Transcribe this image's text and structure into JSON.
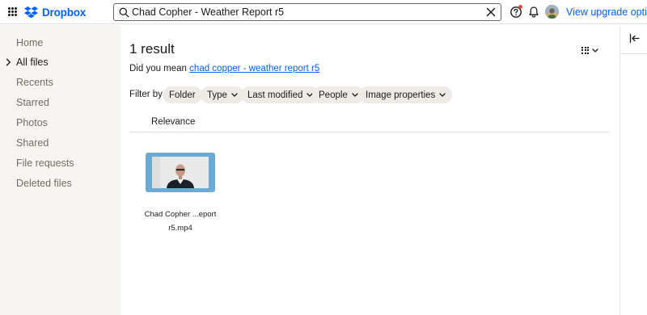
{
  "header": {
    "brand": "Dropbox",
    "brand_color": "#0061fe",
    "search": {
      "value": "Chad Copher - Weather Report r5",
      "placeholder": "Search"
    },
    "icons": [
      "apps-grid-icon",
      "dropbox-logo-icon",
      "search-icon",
      "clear-icon",
      "help-icon",
      "bell-icon"
    ],
    "notification_dot_color": "#d14f3b",
    "upgrade_link": "View upgrade options"
  },
  "sidebar": {
    "items": [
      {
        "label": "Home",
        "active": false
      },
      {
        "label": "All files",
        "active": true
      },
      {
        "label": "Recents",
        "active": false
      },
      {
        "label": "Starred",
        "active": false
      },
      {
        "label": "Photos",
        "active": false
      },
      {
        "label": "Shared",
        "active": false
      },
      {
        "label": "File requests",
        "active": false
      },
      {
        "label": "Deleted files",
        "active": false
      }
    ]
  },
  "main": {
    "result_title": "1 result",
    "did_you_mean_prefix": "Did you mean",
    "did_you_mean_suggestion": "chad copper - weather report r5",
    "filter_label": "Filter by:",
    "filters": [
      {
        "label": "Folder",
        "has_dropdown": false
      },
      {
        "label": "Type",
        "has_dropdown": true
      },
      {
        "label": "Last modified",
        "has_dropdown": true
      },
      {
        "label": "People",
        "has_dropdown": true
      },
      {
        "label": "Image properties",
        "has_dropdown": true
      }
    ],
    "sort_label": "Relevance",
    "files": [
      {
        "name_line1": "Chad Copher ...eport",
        "name_line2": "r5.mp4",
        "thumbnail_color": "#6aaad4"
      }
    ]
  }
}
